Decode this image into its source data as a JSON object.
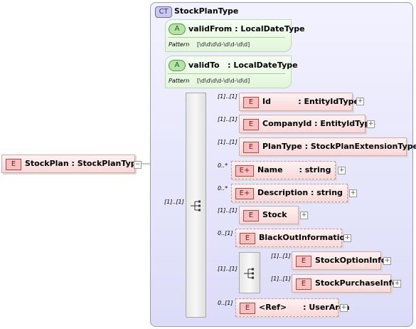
{
  "root": {
    "badge": "E",
    "label": "StockPlan : StockPlanType",
    "expander": "−"
  },
  "complex_type": {
    "badge": "CT",
    "name": "StockPlanType"
  },
  "attributes": [
    {
      "badge": "A",
      "label": "validFrom : LocalDateType",
      "facet_key": "Pattern",
      "facet_value": "[\\d\\d\\d\\d-\\d\\d-\\d\\d]"
    },
    {
      "badge": "A",
      "label": "validTo   : LocalDateType",
      "facet_key": "Pattern",
      "facet_value": "[\\d\\d\\d\\d-\\d\\d-\\d\\d]"
    }
  ],
  "sequence": {
    "cardinality": "[1]..[1]",
    "icon": "sequence-compositor-icon"
  },
  "elements": [
    {
      "cardinality": "[1]..[1]",
      "badge": "E",
      "label": "Id          : EntityIdType",
      "expander": "+"
    },
    {
      "cardinality": "[1]..[1]",
      "badge": "E",
      "label": "CompanyId : EntityIdType",
      "expander": "+"
    },
    {
      "cardinality": "[1]..[1]",
      "badge": "E",
      "label": "PlanType : StockPlanExtensionType",
      "expander": ""
    },
    {
      "cardinality": "0..*",
      "badge": "E+",
      "label": "Name      : string",
      "expander": "+"
    },
    {
      "cardinality": "0..*",
      "badge": "E+",
      "label": "Description : string",
      "expander": "+"
    },
    {
      "cardinality": "[1]..[1]",
      "badge": "E",
      "label": "Stock",
      "expander": "+"
    },
    {
      "cardinality": "0..[1]",
      "badge": "E",
      "label": "BlackOutInformation",
      "expander": "+"
    },
    {
      "cardinality": "[1]..[1]",
      "badge": "",
      "label": "",
      "expander": ""
    },
    {
      "cardinality": "0..[1]",
      "badge": "E",
      "label": "<Ref>      : UserArea",
      "expander": "+"
    }
  ],
  "choice_group": {
    "icon": "choice-compositor-icon",
    "items": [
      {
        "cardinality": "[1]..[1]",
        "badge": "E",
        "label": "StockOptionInfo",
        "expander": "+"
      },
      {
        "cardinality": "[1]..[1]",
        "badge": "E",
        "label": "StockPurchaseInfo",
        "expander": "+"
      }
    ]
  },
  "colors": {
    "element_fill": "#fad8d8",
    "element_border": "#d6a8a8",
    "attribute_fill": "#e2f6da",
    "complex_type_fill": "#dcdcf8"
  }
}
